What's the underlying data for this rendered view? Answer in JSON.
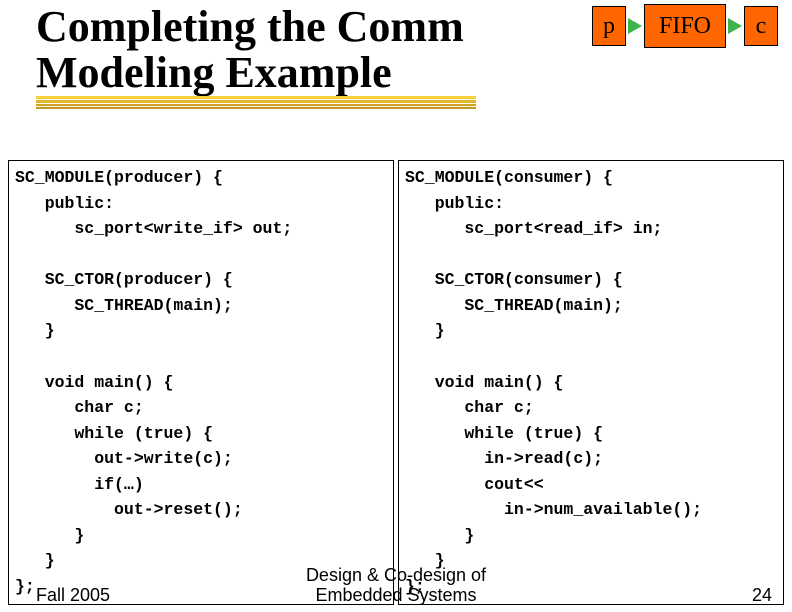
{
  "title_line1": "Completing the Comm",
  "title_line2": "Modeling Example",
  "diagram": {
    "left_box": "p",
    "middle_box": "FIFO",
    "right_box": "c"
  },
  "code": {
    "producer": "SC_MODULE(producer) {\n   public:\n      sc_port<write_if> out;\n\n   SC_CTOR(producer) {\n      SC_THREAD(main);\n   }\n\n   void main() {\n      char c;\n      while (true) {\n        out->write(c);\n        if(…)\n          out->reset();\n      }\n   }\n};",
    "consumer": "SC_MODULE(consumer) {\n   public:\n      sc_port<read_if> in;\n\n   SC_CTOR(consumer) {\n      SC_THREAD(main);\n   }\n\n   void main() {\n      char c;\n      while (true) {\n        in->read(c);\n        cout<<\n          in->num_available();\n      }\n   }\n};"
  },
  "footer": {
    "left": "Fall 2005",
    "center_l1": "Design & Co-design of",
    "center_l2": "Embedded Systems",
    "right": "24"
  }
}
